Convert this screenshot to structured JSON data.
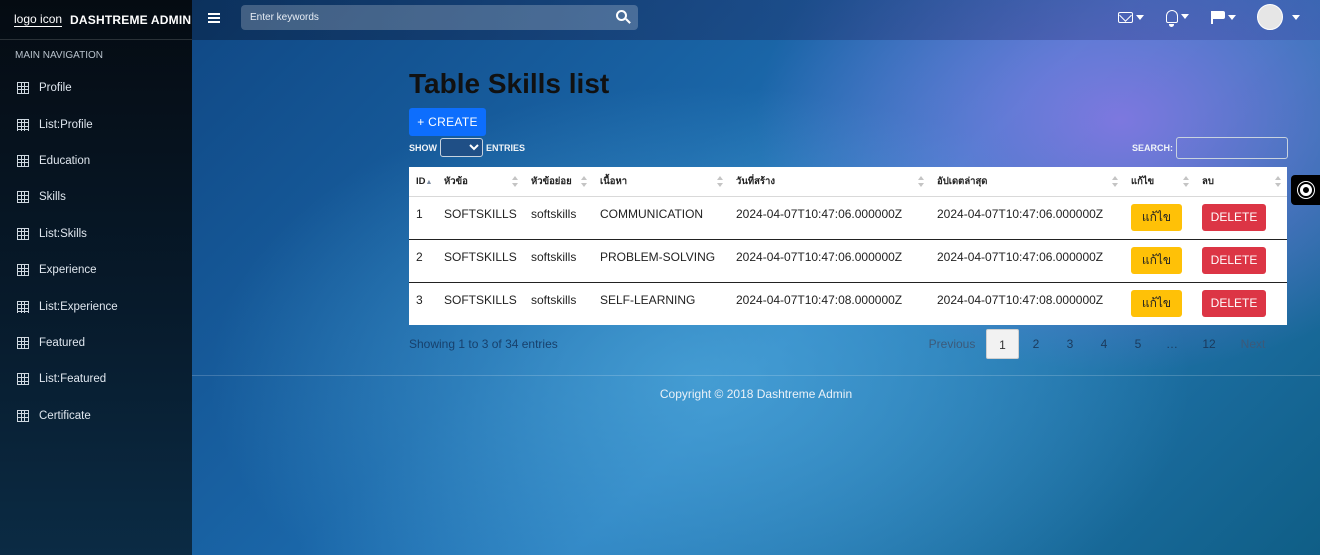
{
  "brand": {
    "logo_alt": "logo icon",
    "name": "DASHTREME ADMIN"
  },
  "sidebar": {
    "header": "MAIN NAVIGATION",
    "items": [
      {
        "label": "Profile"
      },
      {
        "label": "List:Profile"
      },
      {
        "label": "Education"
      },
      {
        "label": "Skills"
      },
      {
        "label": "List:Skills"
      },
      {
        "label": "Experience"
      },
      {
        "label": "List:Experience"
      },
      {
        "label": "Featured"
      },
      {
        "label": "List:Featured"
      },
      {
        "label": "Certificate"
      }
    ]
  },
  "topbar": {
    "search_placeholder": "Enter keywords",
    "icons": [
      "envelope-icon",
      "bell-icon",
      "flag-icon",
      "user-avatar"
    ]
  },
  "main": {
    "title": "Table Skills list",
    "create_label": "+ CREATE",
    "show_label": "SHOW",
    "entries_label": "ENTRIES",
    "search_label": "SEARCH:"
  },
  "table": {
    "columns": [
      "ID",
      "หัวข้อ",
      "หัวข้อย่อย",
      "เนื้อหา",
      "วันที่สร้าง",
      "อัปเดตล่าสุด",
      "แก้ไข",
      "ลบ"
    ],
    "rows": [
      {
        "id": "1",
        "topic": "SOFTSKILLS",
        "subtopic": "softskills",
        "content": "COMMUNICATION",
        "created": "2024-04-07T10:47:06.000000Z",
        "updated": "2024-04-07T10:47:06.000000Z",
        "edit": "แก้ไข",
        "delete": "DELETE"
      },
      {
        "id": "2",
        "topic": "SOFTSKILLS",
        "subtopic": "softskills",
        "content": "PROBLEM-SOLVING",
        "created": "2024-04-07T10:47:06.000000Z",
        "updated": "2024-04-07T10:47:06.000000Z",
        "edit": "แก้ไข",
        "delete": "DELETE"
      },
      {
        "id": "3",
        "topic": "SOFTSKILLS",
        "subtopic": "softskills",
        "content": "SELF-LEARNING",
        "created": "2024-04-07T10:47:08.000000Z",
        "updated": "2024-04-07T10:47:08.000000Z",
        "edit": "แก้ไข",
        "delete": "DELETE"
      }
    ]
  },
  "pagination": {
    "info": "Showing 1 to 3 of 34 entries",
    "previous": "Previous",
    "pages": [
      "1",
      "2",
      "3",
      "4",
      "5",
      "…",
      "12"
    ],
    "active": "1",
    "next": "Next"
  },
  "footer": {
    "copyright": "Copyright © 2018 Dashtreme Admin"
  },
  "colors": {
    "primary": "#0d6efd",
    "warning": "#ffc107",
    "danger": "#dc3545"
  }
}
